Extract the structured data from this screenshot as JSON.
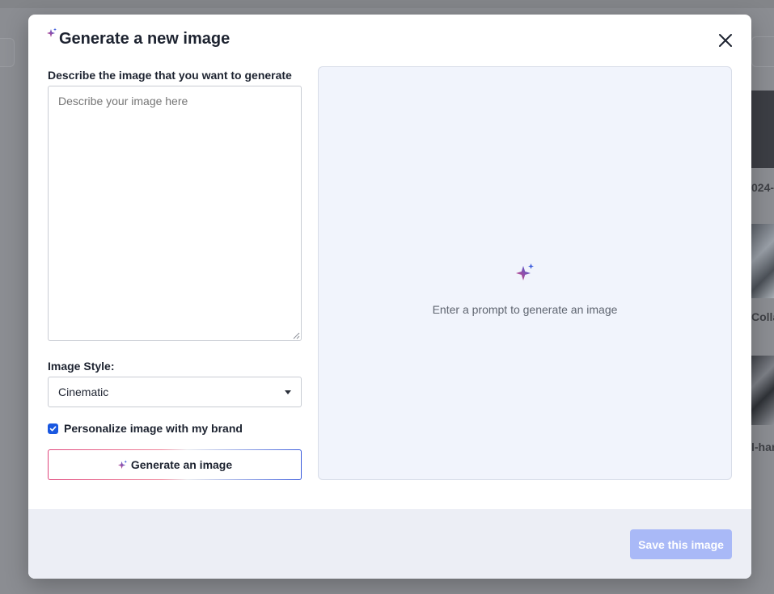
{
  "background": {
    "partial_texts": [
      "024-0",
      "Colla",
      "l-har"
    ]
  },
  "modal": {
    "title": "Generate a new image",
    "prompt": {
      "label": "Describe the image that you want to generate",
      "placeholder": "Describe your image here",
      "value": ""
    },
    "style": {
      "label": "Image Style:",
      "selected": "Cinematic"
    },
    "personalize": {
      "label": "Personalize image with my brand",
      "checked": true
    },
    "generate_button": "Generate an image",
    "preview": {
      "empty_text": "Enter a prompt to generate an image"
    },
    "save_button": "Save this image"
  },
  "icons": {
    "title": "sparkle-icon",
    "close": "close-icon",
    "generate": "sparkle-icon",
    "preview": "sparkle-icon",
    "caret": "chevron-down-icon",
    "check": "check-icon"
  },
  "colors": {
    "accent": "#1a58e0",
    "save_disabled": "#a9b9f7",
    "preview_bg": "#f1f4fc",
    "footer_bg": "#eceef5",
    "sparkle_pink": "#e0457b",
    "sparkle_blue": "#3a5bdc"
  }
}
